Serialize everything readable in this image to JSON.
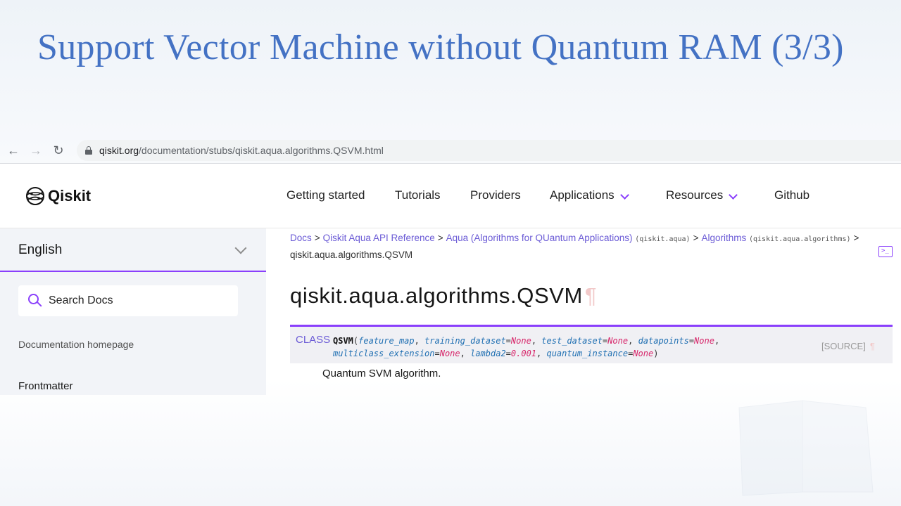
{
  "slide": {
    "title": "Support Vector Machine without Quantum RAM (3/3)"
  },
  "browser": {
    "url_host": "qiskit.org",
    "url_path": "/documentation/stubs/qiskit.aqua.algorithms.QSVM.html",
    "icons": [
      "back-arrow-icon",
      "forward-arrow-icon",
      "reload-icon",
      "lock-icon"
    ]
  },
  "site": {
    "logo_text": "Qiskit",
    "nav": [
      {
        "label": "Getting started"
      },
      {
        "label": "Tutorials"
      },
      {
        "label": "Providers"
      },
      {
        "label": "Applications"
      },
      {
        "label": "Resources"
      },
      {
        "label": "Github"
      }
    ],
    "accent_color": "#8a3ffc"
  },
  "sidebar": {
    "language": "English",
    "search_placeholder": "Search Docs",
    "links": [
      "Documentation homepage",
      "Frontmatter"
    ]
  },
  "breadcrumb": {
    "items": [
      {
        "label": "Docs"
      },
      {
        "label": "Qiskit Aqua API Reference"
      },
      {
        "label": "Aqua (Algorithms for QUantum Applications)",
        "code": "(qiskit.aqua)"
      },
      {
        "label": "Algorithms",
        "code": "(qiskit.aqua.algorithms)"
      }
    ],
    "separator": ">",
    "current": "qiskit.aqua.algorithms.QSVM"
  },
  "page": {
    "heading": "qiskit.aqua.algorithms.QSVM",
    "pilcrow": "¶",
    "signature": {
      "kind": "CLASS",
      "name": "QSVM",
      "params": [
        {
          "name": "feature_map",
          "value": ""
        },
        {
          "name": "training_dataset",
          "value": "None"
        },
        {
          "name": "test_dataset",
          "value": "None"
        },
        {
          "name": "datapoints",
          "value": "None"
        },
        {
          "name": "multiclass_extension",
          "value": "None"
        },
        {
          "name": "lambda2",
          "value": "0.001"
        },
        {
          "name": "quantum_instance",
          "value": "None"
        }
      ],
      "source_label": "[SOURCE]"
    },
    "description": "Quantum SVM algorithm."
  }
}
